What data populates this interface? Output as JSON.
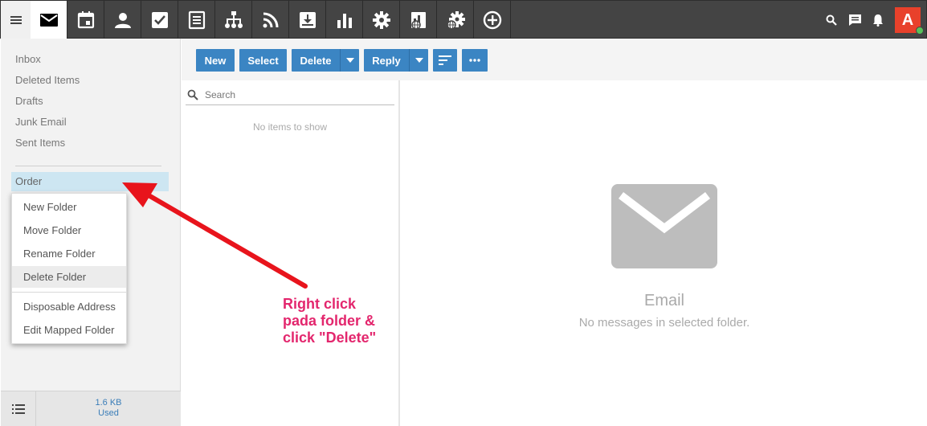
{
  "topbar": {
    "menu_icon": "hamburger-menu-icon",
    "apps": [
      {
        "name": "mail",
        "icon": "envelope-icon",
        "active": true
      },
      {
        "name": "calendar",
        "icon": "calendar-icon"
      },
      {
        "name": "contacts",
        "icon": "person-icon"
      },
      {
        "name": "tasks",
        "icon": "checkbox-icon"
      },
      {
        "name": "notes",
        "icon": "notes-icon"
      },
      {
        "name": "org-chart",
        "icon": "sitemap-icon"
      },
      {
        "name": "feeds",
        "icon": "rss-icon"
      },
      {
        "name": "inbox-download",
        "icon": "download-tray-icon"
      },
      {
        "name": "reports",
        "icon": "bar-chart-icon"
      },
      {
        "name": "settings",
        "icon": "gear-icon"
      },
      {
        "name": "domain-reports",
        "icon": "report-globe-icon"
      },
      {
        "name": "domain-settings",
        "icon": "gear-globe-icon"
      },
      {
        "name": "add",
        "icon": "plus-circle-icon"
      }
    ],
    "right_icons": [
      "search-icon",
      "chat-icon",
      "bell-icon"
    ],
    "avatar_letter": "A",
    "colors": {
      "bar": "#444444",
      "avatar": "#e8412b",
      "presence": "#58c25b"
    }
  },
  "sidebar": {
    "folders": [
      "Inbox",
      "Deleted Items",
      "Drafts",
      "Junk Email",
      "Sent Items"
    ],
    "selected_folder": "Order",
    "context_menu": [
      "New Folder",
      "Move Folder",
      "Rename Folder",
      "Delete Folder",
      "Disposable Address",
      "Edit Mapped Folder"
    ],
    "hovered_menu_item": "Delete Folder",
    "usage_size": "1.6 KB",
    "usage_label": "Used"
  },
  "toolbar": {
    "new_label": "New",
    "select_label": "Select",
    "delete_label": "Delete",
    "reply_label": "Reply",
    "accent_color": "#3b85c3"
  },
  "list": {
    "search_placeholder": "Search",
    "empty_text": "No items to show"
  },
  "reading": {
    "empty_title": "Email",
    "empty_subtitle": "No messages in selected folder."
  },
  "annotation": {
    "lines": [
      "Right click",
      "pada folder &",
      "click \"Delete\""
    ],
    "color": "#e3266d",
    "arrow_color": "#e8141c"
  }
}
